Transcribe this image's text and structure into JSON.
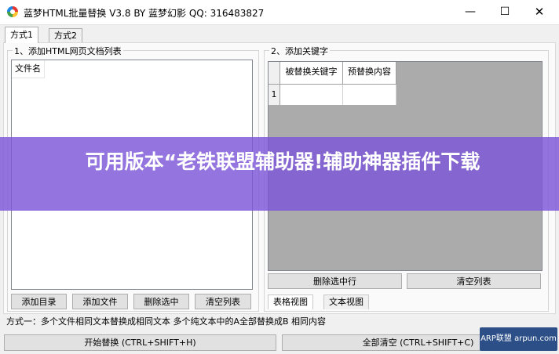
{
  "window": {
    "title": "蓝梦HTML批量替换 V3.8 BY 蓝梦幻影 QQ: 316483827",
    "min_symbol": "—",
    "max_symbol": "☐",
    "close_symbol": "✕"
  },
  "tabs": [
    {
      "label": "方式1",
      "active": true
    },
    {
      "label": "方式2",
      "active": false
    }
  ],
  "left_group": {
    "title": "1、添加HTML网页文档列表",
    "list_header": "文件名",
    "buttons": [
      "添加目录",
      "添加文件",
      "删除选中",
      "清空列表"
    ]
  },
  "right_group": {
    "title": "2、添加关键字",
    "columns": [
      "被替换关键字",
      "预替换内容"
    ],
    "rows": [
      {
        "index": "1",
        "keyword": "",
        "replacement": ""
      }
    ],
    "buttons": [
      "删除选中行",
      "清空列表"
    ],
    "view_tabs": [
      "表格视图",
      "文本视图"
    ]
  },
  "status_text": "方式一：多个文件相同文本替换成相同文本   多个纯文本中的A全部替换成B 相同内容",
  "actions": {
    "start": "开始替换 (CTRL+SHIFT+H)",
    "clear_all": "全部清空 (CTRL+SHIFT+C)"
  },
  "overlay_banner": "可用版本“老铁联盟辅助器!辅助神器插件下载",
  "watermark": "ARP联盟 arpun.com",
  "colors": {
    "banner": "#7c56d7",
    "watermark_bg": "#2c4f88",
    "window_bg": "#f0f0f0"
  }
}
